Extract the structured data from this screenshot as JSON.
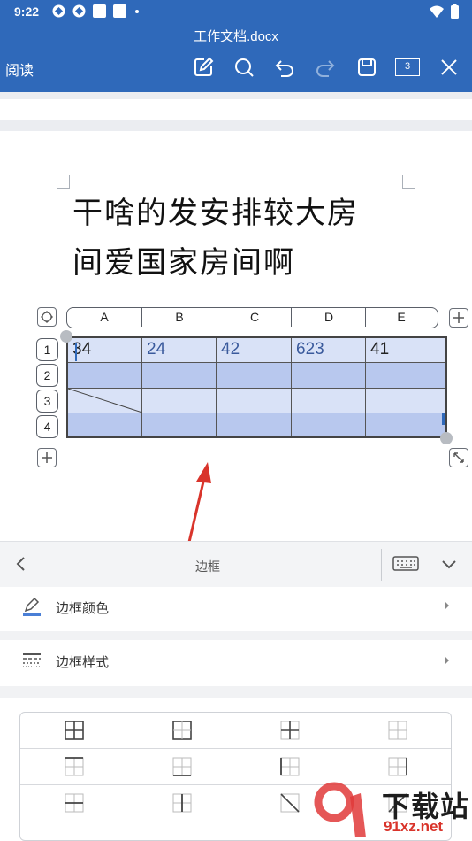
{
  "status_bar": {
    "time": "9:22"
  },
  "header": {
    "doc_title": "工作文档.docx",
    "read_label": "阅读",
    "page_count": "3",
    "icons": [
      "edit-icon",
      "search-icon",
      "undo-icon",
      "redo-icon",
      "save-icon",
      "page-count-icon",
      "close-icon"
    ]
  },
  "document": {
    "line1": "干啥的发安排较大房",
    "line2": "间爱国家房间啊"
  },
  "table": {
    "columns": [
      "A",
      "B",
      "C",
      "D",
      "E"
    ],
    "rows": [
      "1",
      "2",
      "3",
      "4"
    ],
    "cells": [
      [
        "34",
        "24",
        "42",
        "623",
        "41"
      ],
      [
        "",
        "",
        "",
        "",
        ""
      ],
      [
        "",
        "",
        "",
        "",
        ""
      ],
      [
        "",
        "",
        "",
        "",
        ""
      ]
    ]
  },
  "panel": {
    "title": "边框",
    "options": [
      {
        "label": "边框颜色",
        "icon": "pen-color-icon"
      },
      {
        "label": "边框样式",
        "icon": "line-style-icon"
      }
    ]
  },
  "colors": {
    "header_bg": "#2f69ba",
    "cell_fill_light": "#d9e2f7",
    "cell_fill_dark": "#b8c8ee",
    "arrow": "#d9342b"
  },
  "watermark": {
    "text": "下载站",
    "sub": "91xz.net"
  }
}
